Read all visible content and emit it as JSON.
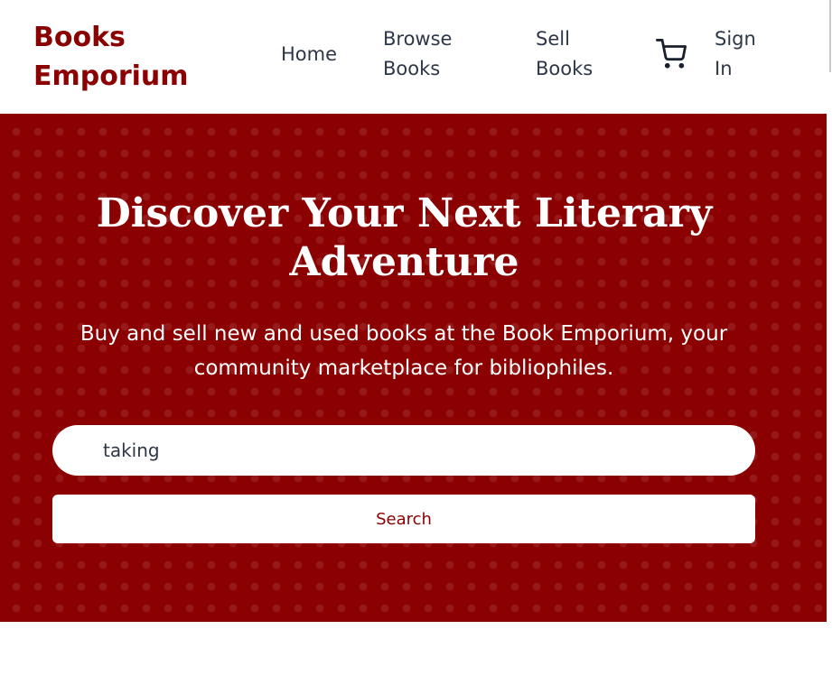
{
  "header": {
    "logo": "Books Emporium",
    "nav": {
      "home": "Home",
      "browse": "Browse Books",
      "sell": "Sell Books",
      "cart_icon": "cart-icon",
      "signin": "Sign In"
    }
  },
  "hero": {
    "title": "Discover Your Next Literary Adventure",
    "subtitle": "Buy and sell new and used books at the Book Emporium, your community marketplace for bibliophiles.",
    "search": {
      "value": "taking",
      "button_label": "Search"
    }
  },
  "colors": {
    "brand": "#8b0000",
    "text": "#2d3748",
    "hero_text": "#ffffff"
  }
}
